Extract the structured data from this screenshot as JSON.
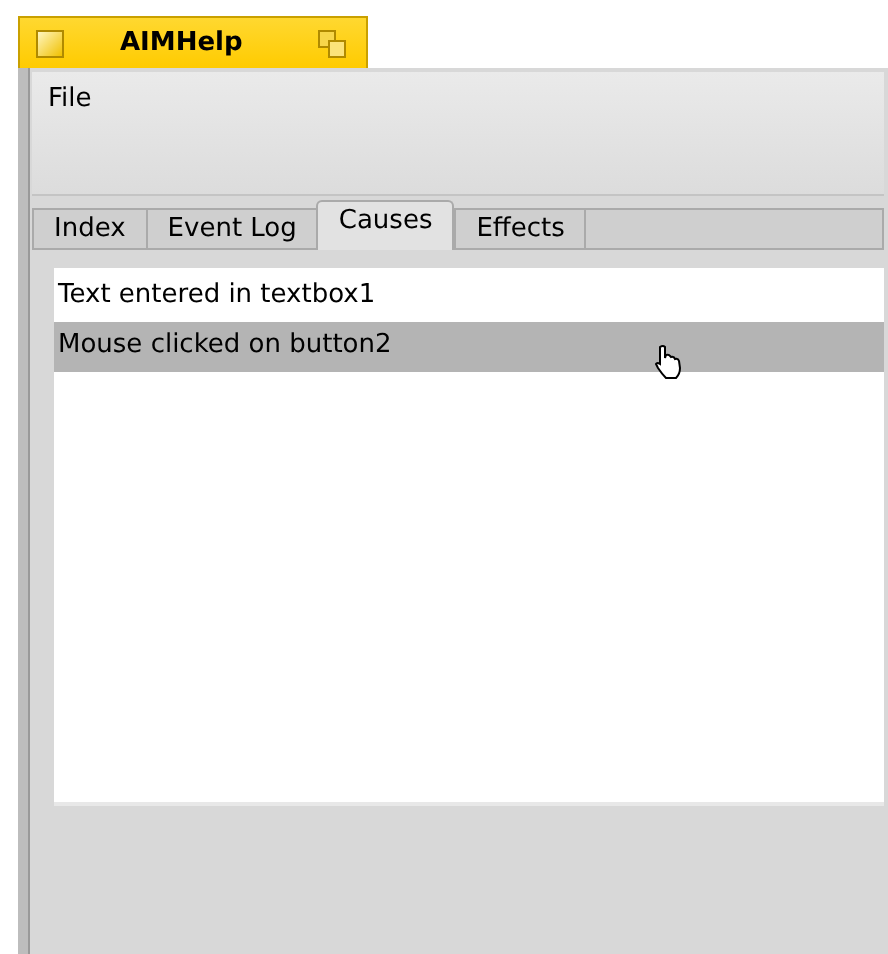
{
  "window": {
    "title": "AIMHelp"
  },
  "menu": [
    "File"
  ],
  "tabs": [
    {
      "label": "Index",
      "selected": false
    },
    {
      "label": "Event Log",
      "selected": false
    },
    {
      "label": "Causes",
      "selected": true
    },
    {
      "label": "Effects",
      "selected": false
    }
  ],
  "list": [
    {
      "text": "Text entered in textbox1",
      "selected": false
    },
    {
      "text": "Mouse clicked on button2",
      "selected": true
    }
  ]
}
